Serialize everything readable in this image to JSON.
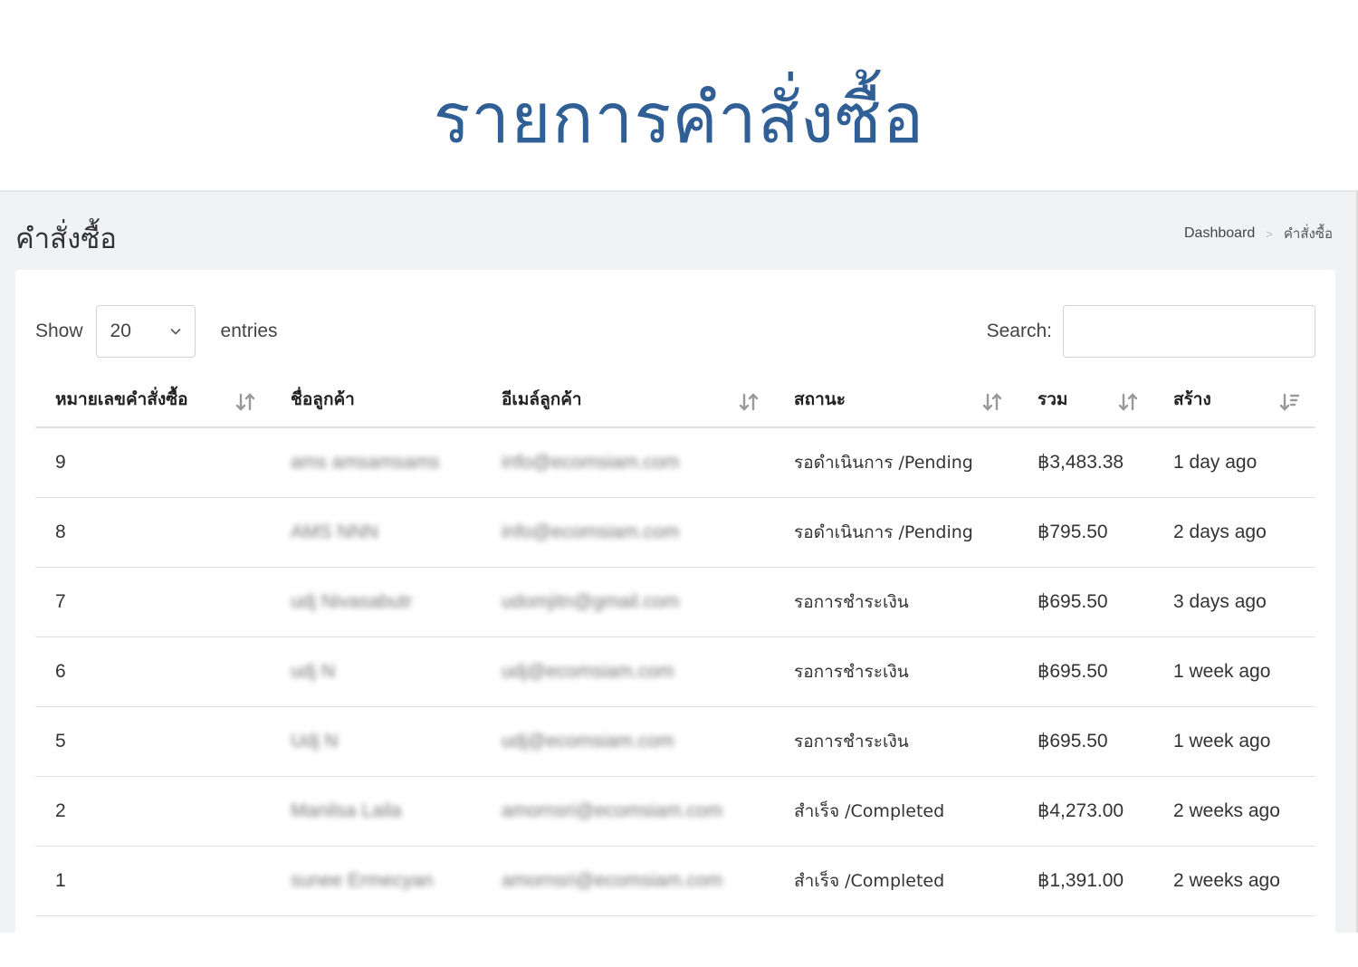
{
  "hero": {
    "title": "รายการคำสั่งซื้อ"
  },
  "header": {
    "title": "คำสั่งซื้อ",
    "breadcrumb": {
      "home": "Dashboard",
      "separator": ">",
      "current": "คำสั่งซื้อ"
    }
  },
  "controls": {
    "show_label": "Show",
    "page_size": "20",
    "entries_label": "entries",
    "search_label": "Search:",
    "search_value": ""
  },
  "table": {
    "columns": [
      "หมายเลขคำสั่งซื้อ",
      "ชื่อลูกค้า",
      "อีเมล์ลูกค้า",
      "สถานะ",
      "รวม",
      "สร้าง"
    ],
    "rows": [
      {
        "id": "9",
        "name": "ams amsamsams",
        "email": "info@ecomsiam.com",
        "status": "รอดำเนินการ /Pending",
        "total": "฿3,483.38",
        "created": "1 day ago"
      },
      {
        "id": "8",
        "name": "AMS NNN",
        "email": "info@ecomsiam.com",
        "status": "รอดำเนินการ /Pending",
        "total": "฿795.50",
        "created": "2 days ago"
      },
      {
        "id": "7",
        "name": "udj Nivasabutr",
        "email": "udomjitn@gmail.com",
        "status": "รอการชำระเงิน",
        "total": "฿695.50",
        "created": "3 days ago"
      },
      {
        "id": "6",
        "name": "udj N",
        "email": "udj@ecomsiam.com",
        "status": "รอการชำระเงิน",
        "total": "฿695.50",
        "created": "1 week ago"
      },
      {
        "id": "5",
        "name": "Udj N",
        "email": "udj@ecomsiam.com",
        "status": "รอการชำระเงิน",
        "total": "฿695.50",
        "created": "1 week ago"
      },
      {
        "id": "2",
        "name": "Manilsa Laila",
        "email": "amornsri@ecomsiam.com",
        "status": "สำเร็จ /Completed",
        "total": "฿4,273.00",
        "created": "2 weeks ago"
      },
      {
        "id": "1",
        "name": "sunee Ermecyan",
        "email": "amornsri@ecomsiam.com",
        "status": "สำเร็จ /Completed",
        "total": "฿1,391.00",
        "created": "2 weeks ago"
      }
    ]
  },
  "colors": {
    "title_blue": "#2f5f95",
    "app_bg": "#f1f2f4",
    "border": "#dee2e6"
  },
  "icons": {
    "sort": "sort-arrows-icon",
    "sort_desc": "sort-desc-icon",
    "select": "chevron-down-icon"
  }
}
